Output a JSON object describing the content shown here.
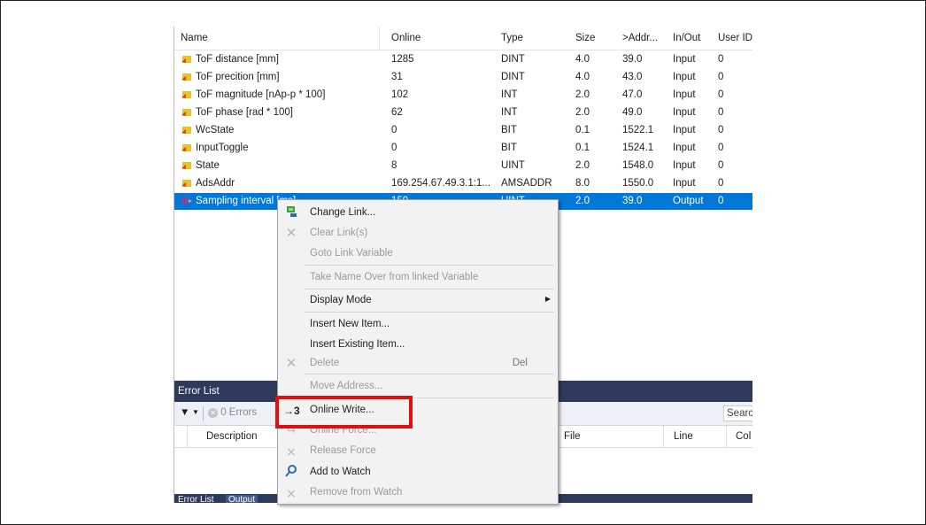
{
  "table": {
    "columns": [
      "Name",
      "Online",
      "Type",
      "Size",
      ">Addr...",
      "In/Out",
      "User ID"
    ],
    "rows": [
      {
        "name": "ToF distance [mm]",
        "online": "1285",
        "type": "DINT",
        "size": "4.0",
        "addr": "39.0",
        "inout": "Input",
        "userid": "0"
      },
      {
        "name": "ToF precition [mm]",
        "online": "31",
        "type": "DINT",
        "size": "4.0",
        "addr": "43.0",
        "inout": "Input",
        "userid": "0"
      },
      {
        "name": "ToF magnitude [nAp-p * 100]",
        "online": "102",
        "type": "INT",
        "size": "2.0",
        "addr": "47.0",
        "inout": "Input",
        "userid": "0"
      },
      {
        "name": "ToF phase [rad * 100]",
        "online": "62",
        "type": "INT",
        "size": "2.0",
        "addr": "49.0",
        "inout": "Input",
        "userid": "0"
      },
      {
        "name": "WcState",
        "online": "0",
        "type": "BIT",
        "size": "0.1",
        "addr": "1522.1",
        "inout": "Input",
        "userid": "0"
      },
      {
        "name": "InputToggle",
        "online": "0",
        "type": "BIT",
        "size": "0.1",
        "addr": "1524.1",
        "inout": "Input",
        "userid": "0"
      },
      {
        "name": "State",
        "online": "8",
        "type": "UINT",
        "size": "2.0",
        "addr": "1548.0",
        "inout": "Input",
        "userid": "0"
      },
      {
        "name": "AdsAddr",
        "online": "169.254.67.49.3.1:1...",
        "type": "AMSADDR",
        "size": "8.0",
        "addr": "1550.0",
        "inout": "Input",
        "userid": "0"
      },
      {
        "name": "Sampling interval [ms]",
        "online": "150",
        "type": "UINT",
        "size": "2.0",
        "addr": "39.0",
        "inout": "Output",
        "userid": "0"
      }
    ]
  },
  "error_list": {
    "title": "Error List",
    "errors_label": "0 Errors",
    "search_placeholder": "Search",
    "columns": [
      "Description",
      "File",
      "Line",
      "Col"
    ],
    "bottom_tabs": [
      "Error List",
      "Output"
    ]
  },
  "context_menu": {
    "items": [
      {
        "label": "Change Link...",
        "icon": "link-icon",
        "disabled": false
      },
      {
        "label": "Clear Link(s)",
        "icon": "clear-link-icon",
        "disabled": true
      },
      {
        "label": "Goto Link Variable",
        "icon": "",
        "disabled": true
      },
      {
        "label": "Take Name Over from linked Variable",
        "icon": "",
        "disabled": true
      },
      {
        "label": "Display Mode",
        "icon": "",
        "disabled": false,
        "submenu": true
      },
      {
        "label": "Insert New Item...",
        "icon": "",
        "disabled": false
      },
      {
        "label": "Insert Existing Item...",
        "icon": "",
        "disabled": false
      },
      {
        "label": "Delete",
        "icon": "delete-icon",
        "disabled": true,
        "shortcut": "Del"
      },
      {
        "label": "Move Address...",
        "icon": "",
        "disabled": true
      },
      {
        "label": "Online Write...",
        "icon": "online-write-icon",
        "disabled": false
      },
      {
        "label": "Online Force...",
        "icon": "online-force-icon",
        "disabled": true
      },
      {
        "label": "Release Force",
        "icon": "release-force-icon",
        "disabled": true
      },
      {
        "label": "Add to Watch",
        "icon": "add-watch-icon",
        "disabled": false
      },
      {
        "label": "Remove from Watch",
        "icon": "remove-watch-icon",
        "disabled": true
      }
    ],
    "online_write_icon_text": "→3"
  },
  "colors": {
    "selection": "#0078d7",
    "highlight_box": "#e01010",
    "panel_header": "#2d3a5c"
  }
}
